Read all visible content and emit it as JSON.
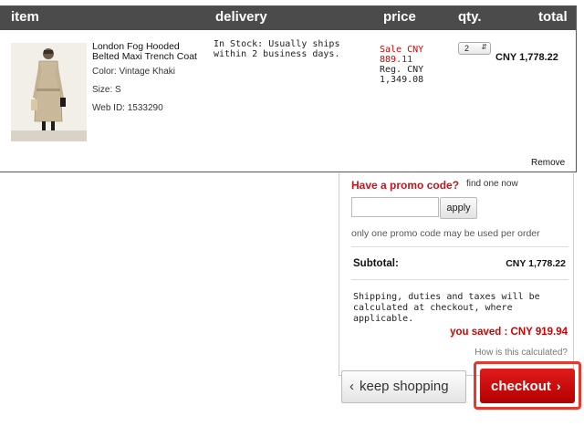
{
  "header": {
    "item": "item",
    "delivery": "delivery",
    "price": "price",
    "qty": "qty.",
    "total": "total"
  },
  "product": {
    "name": "London Fog Hooded Belted Maxi Trench Coat",
    "color_label": "Color:",
    "color_value": "Vintage Khaki",
    "size_label": "Size:",
    "size_value": "S",
    "webid_label": "Web ID:",
    "webid_value": "1533290",
    "delivery": "In Stock: Usually ships within 2 business days.",
    "sale_price": "Sale CNY 889.11",
    "reg_price": "Reg. CNY 1,349.08",
    "qty": "2",
    "total": "CNY 1,778.22",
    "remove": "Remove"
  },
  "promo": {
    "title": "Have a promo code?",
    "find": "find one now",
    "input_value": "",
    "apply": "apply",
    "note": "only one promo code may be used per order"
  },
  "summary": {
    "subtotal_label": "Subtotal:",
    "subtotal_value": "CNY 1,778.22",
    "shipping_note": "Shipping, duties and taxes will be calculated at checkout, where applicable.",
    "saved": "you saved : CNY 919.94",
    "how_calc": "How is this calculated?"
  },
  "actions": {
    "keep_shopping": "keep shopping",
    "checkout": "checkout"
  },
  "icons": {
    "chevron_left": "chevron-left-icon",
    "chevron_right": "chevron-right-icon"
  },
  "colors": {
    "header_bg": "#4b4b4b",
    "accent_red": "#d40000",
    "checkout_outline": "#e23b2e"
  }
}
